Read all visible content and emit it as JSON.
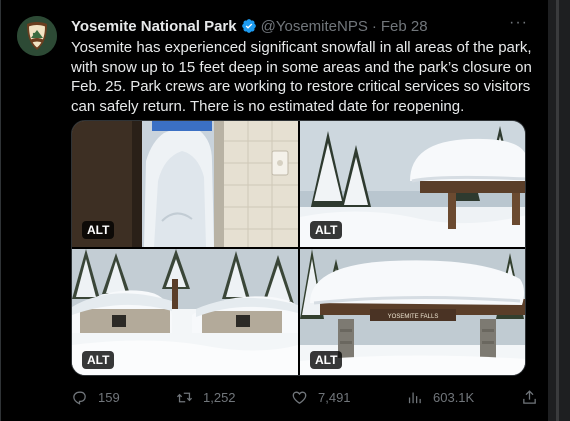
{
  "tweet": {
    "author_name": "Yosemite National Park",
    "handle": "@YosemiteNPS",
    "separator": "·",
    "date": "Feb 28",
    "more": "···",
    "text": "Yosemite has experienced significant snowfall in all areas of the park, with snow up to 15 feet deep in some areas and the park’s closure on Feb. 25. Park crews are working to restore critical services so visitors can safely return. There is no estimated date for reopening."
  },
  "media": [
    {
      "alt_label": "ALT",
      "icon": "snow-blocked-door-photo"
    },
    {
      "alt_label": "ALT",
      "icon": "snow-covered-shelter-photo"
    },
    {
      "alt_label": "ALT",
      "icon": "snow-buried-cabins-photo"
    },
    {
      "alt_label": "ALT",
      "icon": "yosemite-falls-sign-shelter-photo",
      "sign_text": "YOSEMITE FALLS"
    }
  ],
  "actions": {
    "replies": "159",
    "reposts": "1,252",
    "likes": "7,491",
    "views": "603.1K"
  },
  "colors": {
    "background": "#000000",
    "text": "#e7e9ea",
    "secondary": "#71767b",
    "verified": "#1d9bf0",
    "border": "#2f3336"
  }
}
